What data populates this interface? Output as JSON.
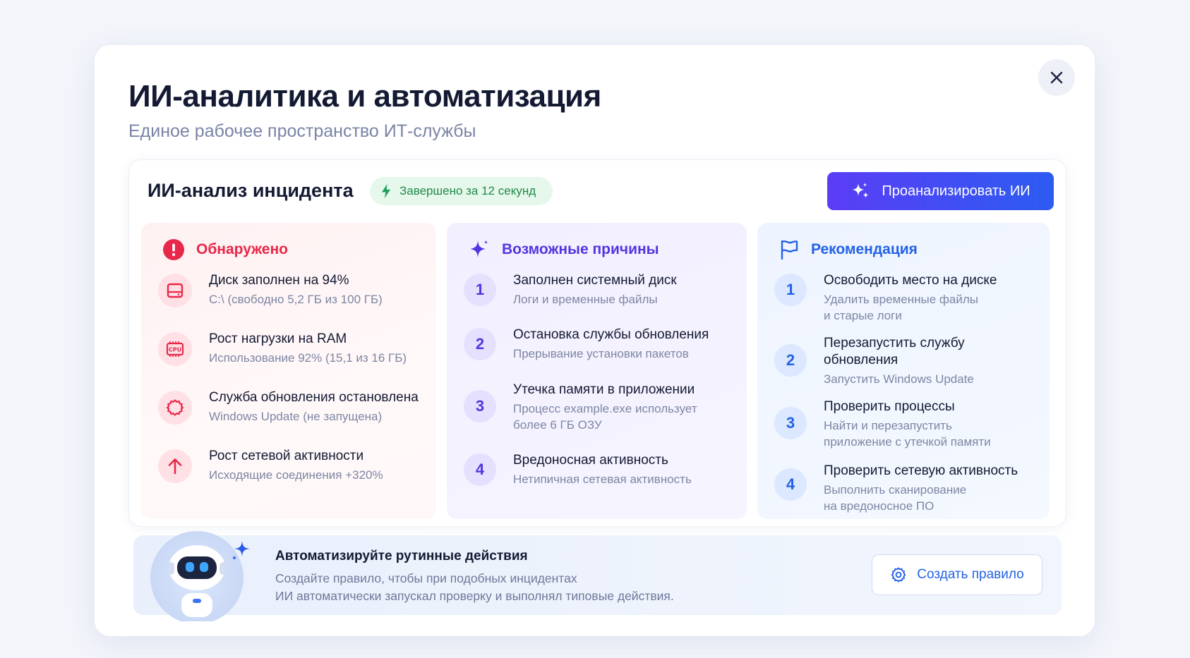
{
  "modal": {
    "title": "ИИ-аналитика и автоматизация",
    "subtitle": "Единое рабочее пространство ИТ-службы",
    "close_icon": "close-icon"
  },
  "panel": {
    "title": "ИИ-анализ инцидента",
    "badge": "Завершено за 12 секунд",
    "analyze_button": "Проанализировать ИИ"
  },
  "detected": {
    "heading": "Обнаружено",
    "items": [
      {
        "title": "Диск заполнен на 94%",
        "sub": "C:\\ (свободно 5,2 ГБ из 100 ГБ)",
        "icon": "disk-icon"
      },
      {
        "title": "Рост нагрузки на RAM",
        "sub": "Использование 92% (15,1 из 16 ГБ)",
        "icon": "cpu-icon"
      },
      {
        "title": "Служба обновления остановлена",
        "sub": "Windows Update (не запущена)",
        "icon": "gear-icon"
      },
      {
        "title": "Рост сетевой активности",
        "sub": "Исходящие соединения +320%",
        "icon": "arrow-up-icon"
      }
    ]
  },
  "causes": {
    "heading": "Возможные причины",
    "items": [
      {
        "num": "1",
        "title": "Заполнен системный диск",
        "sub": "Логи и временные файлы"
      },
      {
        "num": "2",
        "title": "Остановка службы обновления",
        "sub": "Прерывание установки пакетов"
      },
      {
        "num": "3",
        "title": "Утечка памяти в приложении",
        "sub1": "Процесс example.exe использует",
        "sub2": "более 6 ГБ ОЗУ"
      },
      {
        "num": "4",
        "title": "Вредоносная активность",
        "sub": "Нетипичная сетевая активность"
      }
    ]
  },
  "recommendation": {
    "heading": "Рекомендация",
    "items": [
      {
        "num": "1",
        "title": "Освободить место на диске",
        "sub1": "Удалить временные файлы",
        "sub2": "и старые логи"
      },
      {
        "num": "2",
        "title1": "Перезапустить службу",
        "title2": "обновления",
        "sub": "Запустить Windows Update"
      },
      {
        "num": "3",
        "title": "Проверить процессы",
        "sub1": "Найти и перезапустить",
        "sub2": "приложение с утечкой памяти"
      },
      {
        "num": "4",
        "title": "Проверить сетевую активность",
        "sub1": "Выполнить сканирование",
        "sub2": "на вредоносное ПО"
      }
    ]
  },
  "footer": {
    "title": "Автоматизируйте рутинные действия",
    "text1": "Создайте правило, чтобы при подобных инцидентах",
    "text2": "ИИ автоматически запускал проверку и выполнял типовые действия.",
    "button": "Создать правило"
  },
  "colors": {
    "alert": "#e8284a",
    "causes": "#5534e0",
    "recommendation": "#2362e6",
    "success": "#1f8a47"
  }
}
